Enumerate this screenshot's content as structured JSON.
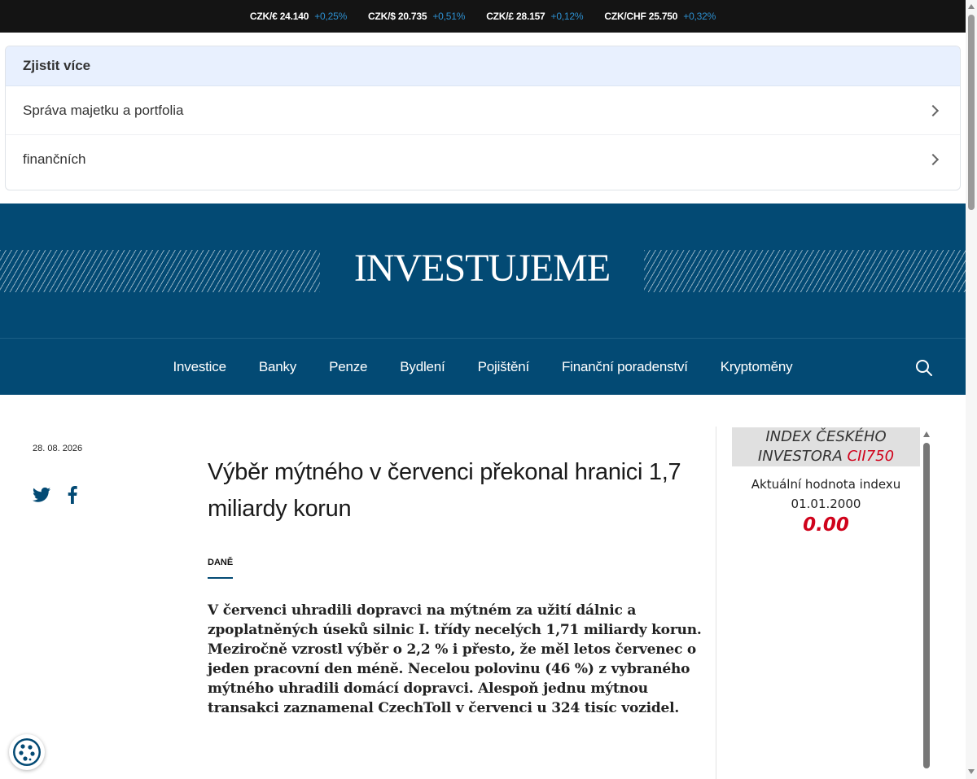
{
  "ticker": [
    {
      "pair": "CZK/€ 24.140",
      "change": "+0,25%"
    },
    {
      "pair": "CZK/$ 20.735",
      "change": "+0,51%"
    },
    {
      "pair": "CZK/£ 28.157",
      "change": "+0,12%"
    },
    {
      "pair": "CZK/CHF 25.750",
      "change": "+0,32%"
    }
  ],
  "ad": {
    "header": "Zjistit více",
    "items": [
      "Správa majetku a portfolia",
      "finančních"
    ]
  },
  "brand": {
    "logo": "INVESTUJEME"
  },
  "nav": {
    "items": [
      "Investice",
      "Banky",
      "Penze",
      "Bydlení",
      "Pojištění",
      "Finanční poradenství",
      "Kryptoměny"
    ]
  },
  "article": {
    "date": "28. 08. 2026",
    "headline": "Výběr mýtného v červenci překonal hranici 1,7 miliardy korun",
    "category": "DANĚ",
    "perex": "V červenci uhradili dopravci na mýtném za užití dálnic a zpoplatněných úseků silnic I. třídy necelých 1,71 miliardy korun. Meziročně vzrostl výběr o 2,2 % i přesto, že měl letos červenec o jeden pracovní den méně. Necelou polovinu (46 %) z vybraného mýtného uhradili domácí dopravci. Alespoň jednu mýtnou transakci zaznamenal CzechToll v červenci u 324 tisíc vozidel."
  },
  "index_widget": {
    "title_line1": "INDEX ČESKÉHO",
    "title_line2": "INVESTORA",
    "code": "CII750",
    "label": "Aktuální hodnota indexu",
    "date": "01.01.2000",
    "value": "0.00"
  },
  "colors": {
    "brand_blue": "#034a74",
    "ticker_bg": "#141414",
    "change_blue": "#2d8fcf",
    "index_red": "#d0021b"
  }
}
